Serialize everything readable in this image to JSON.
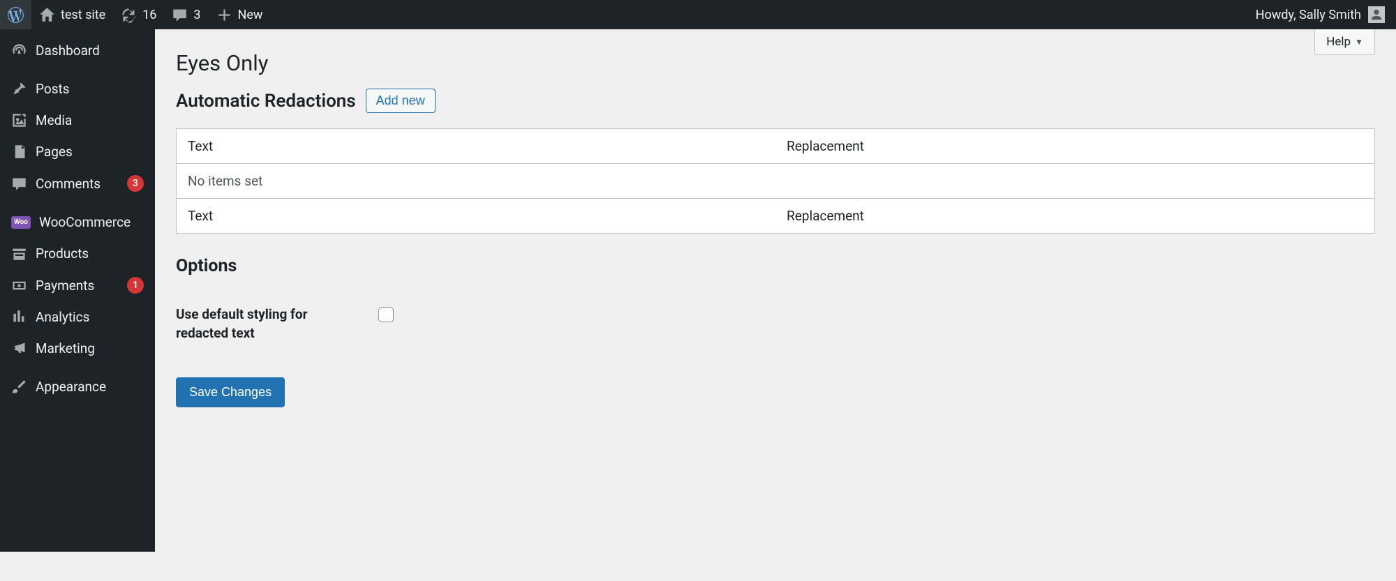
{
  "admin_bar": {
    "site_name": "test site",
    "updates_count": "16",
    "comments_count": "3",
    "new_label": "New",
    "howdy_text": "Howdy, Sally Smith"
  },
  "sidebar": {
    "dashboard": "Dashboard",
    "posts": "Posts",
    "media": "Media",
    "pages": "Pages",
    "comments": "Comments",
    "comments_badge": "3",
    "woocommerce": "WooCommerce",
    "products": "Products",
    "payments": "Payments",
    "payments_badge": "1",
    "analytics": "Analytics",
    "marketing": "Marketing",
    "appearance": "Appearance"
  },
  "help_label": "Help",
  "page": {
    "title": "Eyes Only",
    "redactions_heading": "Automatic Redactions",
    "add_new": "Add new",
    "table": {
      "col_text": "Text",
      "col_replacement": "Replacement",
      "empty": "No items set"
    },
    "options_heading": "Options",
    "option_default_styling": "Use default styling for redacted text",
    "save_button": "Save Changes"
  }
}
